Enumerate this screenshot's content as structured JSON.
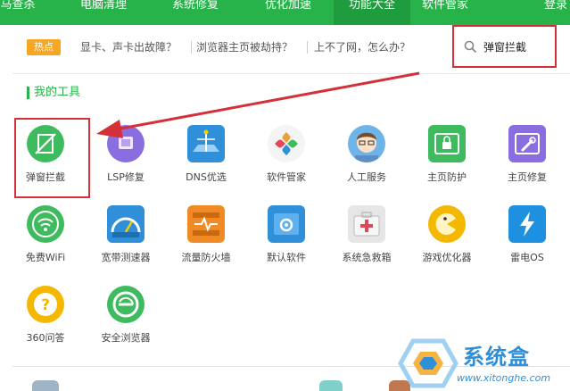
{
  "nav": {
    "items": [
      "马查杀",
      "电脑清理",
      "系统修复",
      "优化加速",
      "功能大全",
      "软件管家",
      "登录"
    ],
    "active": "功能大全",
    "bg_color": "#27b34a"
  },
  "hot": {
    "badge": "热点",
    "links": [
      "显卡、声卡出故障？",
      "浏览器主页被劫持？",
      "上不了网，怎么办？"
    ]
  },
  "search": {
    "value": "弹窗拦截",
    "icon": "search-icon"
  },
  "section": {
    "title": "我的工具"
  },
  "tools": [
    {
      "label": "弹窗拦截",
      "icon": "popup-block-icon",
      "color": "#3dbb5e"
    },
    {
      "label": "LSP修复",
      "icon": "lsp-repair-icon",
      "color": "#8a6ee0"
    },
    {
      "label": "DNS优选",
      "icon": "dns-icon",
      "color": "#2f8fd8"
    },
    {
      "label": "软件管家",
      "icon": "software-manager-icon",
      "color": "#e9a23b"
    },
    {
      "label": "人工服务",
      "icon": "human-service-icon",
      "color": "#6fb4e8"
    },
    {
      "label": "主页防护",
      "icon": "homepage-lock-icon",
      "color": "#3dbb5e"
    },
    {
      "label": "主页修复",
      "icon": "homepage-repair-icon",
      "color": "#8a6ee0"
    },
    {
      "label": "免费WiFi",
      "icon": "wifi-icon",
      "color": "#3dbb5e"
    },
    {
      "label": "宽带测速器",
      "icon": "speed-test-icon",
      "color": "#2f8fd8"
    },
    {
      "label": "流量防火墙",
      "icon": "firewall-icon",
      "color": "#f08a24"
    },
    {
      "label": "默认软件",
      "icon": "default-software-icon",
      "color": "#2f8fd8"
    },
    {
      "label": "系统急救箱",
      "icon": "first-aid-icon",
      "color": "#d9d9d9"
    },
    {
      "label": "游戏优化器",
      "icon": "game-icon",
      "color": "#f5b800"
    },
    {
      "label": "雷电OS",
      "icon": "thunder-os-icon",
      "color": "#1e90e0"
    },
    {
      "label": "360问答",
      "icon": "qa-icon",
      "color": "#f5b800"
    },
    {
      "label": "安全浏览器",
      "icon": "browser-icon",
      "color": "#3dbb5e"
    }
  ],
  "watermark": {
    "brand": "系统盒",
    "url": "www.xitonghe.com"
  }
}
